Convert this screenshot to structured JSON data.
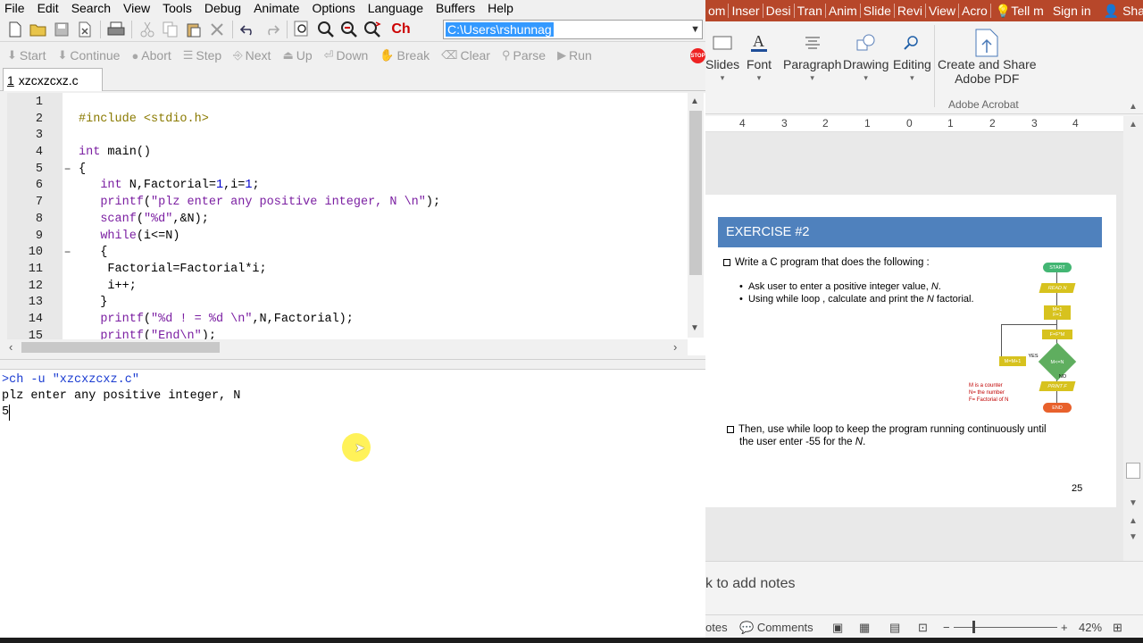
{
  "ide": {
    "menu": [
      "File",
      "Edit",
      "Search",
      "View",
      "Tools",
      "Debug",
      "Animate",
      "Options",
      "Language",
      "Buffers",
      "Help"
    ],
    "path": "C:\\Users\\rshunnag",
    "ch_label": "Ch",
    "debug_buttons": [
      "Start",
      "Continue",
      "Abort",
      "Step",
      "Next",
      "Up",
      "Down",
      "Break",
      "Clear",
      "Parse",
      "Run"
    ],
    "stop_label": "STOP",
    "tab": {
      "number": "1",
      "filename": "xzcxzcxz.c"
    },
    "code": [
      {
        "n": "1",
        "fold": "",
        "text": ""
      },
      {
        "n": "2",
        "fold": "",
        "text": "#include <stdio.h>"
      },
      {
        "n": "3",
        "fold": "",
        "text": ""
      },
      {
        "n": "4",
        "fold": "",
        "text": "int main()"
      },
      {
        "n": "5",
        "fold": "−",
        "text": "{"
      },
      {
        "n": "6",
        "fold": "",
        "text": "   int N,Factorial=1,i=1;"
      },
      {
        "n": "7",
        "fold": "",
        "text": "   printf(\"plz enter any positive integer, N \\n\");"
      },
      {
        "n": "8",
        "fold": "",
        "text": "   scanf(\"%d\",&N);"
      },
      {
        "n": "9",
        "fold": "",
        "text": "   while(i<=N)"
      },
      {
        "n": "10",
        "fold": "−",
        "text": "   {"
      },
      {
        "n": "11",
        "fold": "",
        "text": "    Factorial=Factorial*i;"
      },
      {
        "n": "12",
        "fold": "",
        "text": "    i++;"
      },
      {
        "n": "13",
        "fold": "",
        "text": "   }"
      },
      {
        "n": "14",
        "fold": "",
        "text": "   printf(\"%d ! = %d \\n\",N,Factorial);"
      },
      {
        "n": "15",
        "fold": "",
        "text": "   printf(\"End\\n\");"
      }
    ],
    "output": [
      ">ch -u \"xzcxzcxz.c\"",
      "plz enter any positive integer, N",
      "5"
    ]
  },
  "ppt": {
    "tabs": [
      "om",
      "Inser",
      "Desi",
      "Tran",
      "Anim",
      "Slide",
      "Revi",
      "View",
      "Acro"
    ],
    "tell_me": "Tell m",
    "sign_in": "Sign in",
    "share": "Share",
    "ribbon": {
      "slides": "Slides",
      "font": "Font",
      "paragraph": "Paragraph",
      "drawing": "Drawing",
      "editing": "Editing",
      "create_share_1": "Create and Share",
      "create_share_2": "Adobe PDF",
      "group_label": "Adobe Acrobat"
    },
    "ruler": [
      "4",
      "3",
      "2",
      "1",
      "0",
      "1",
      "2",
      "3",
      "4"
    ],
    "slide": {
      "title": "EXERCISE #2",
      "bullet1": "Write a C program that does the following  :",
      "sub1_prefix": "Ask user to enter a positive integer value, ",
      "sub1_var": "N",
      "sub1_suffix": ".",
      "sub2_prefix": "Using while loop , calculate and print the ",
      "sub2_var": "N",
      "sub2_suffix": " factorial.",
      "bullet2_line1": "Then, use while loop to keep the program running continuously until",
      "bullet2_line2_prefix": "the user enter -55 for the ",
      "bullet2_line2_var": "N",
      "bullet2_line2_suffix": ".",
      "page_number": "25",
      "flowchart": {
        "start": "START",
        "read": "READ N",
        "init1": "M=1",
        "init2": "F=1",
        "assign": "F=F*M",
        "decision": "M<=N",
        "increment": "M=M+1",
        "yes": "YES",
        "no": "NO",
        "print": "PRINT F",
        "end": "END",
        "note1": "M is a counter",
        "note2": "N= the number",
        "note3": "F= Factorial of N"
      }
    },
    "notes_placeholder": "k to add notes",
    "status": {
      "notes": "otes",
      "comments": "Comments",
      "zoom": "42%"
    }
  }
}
